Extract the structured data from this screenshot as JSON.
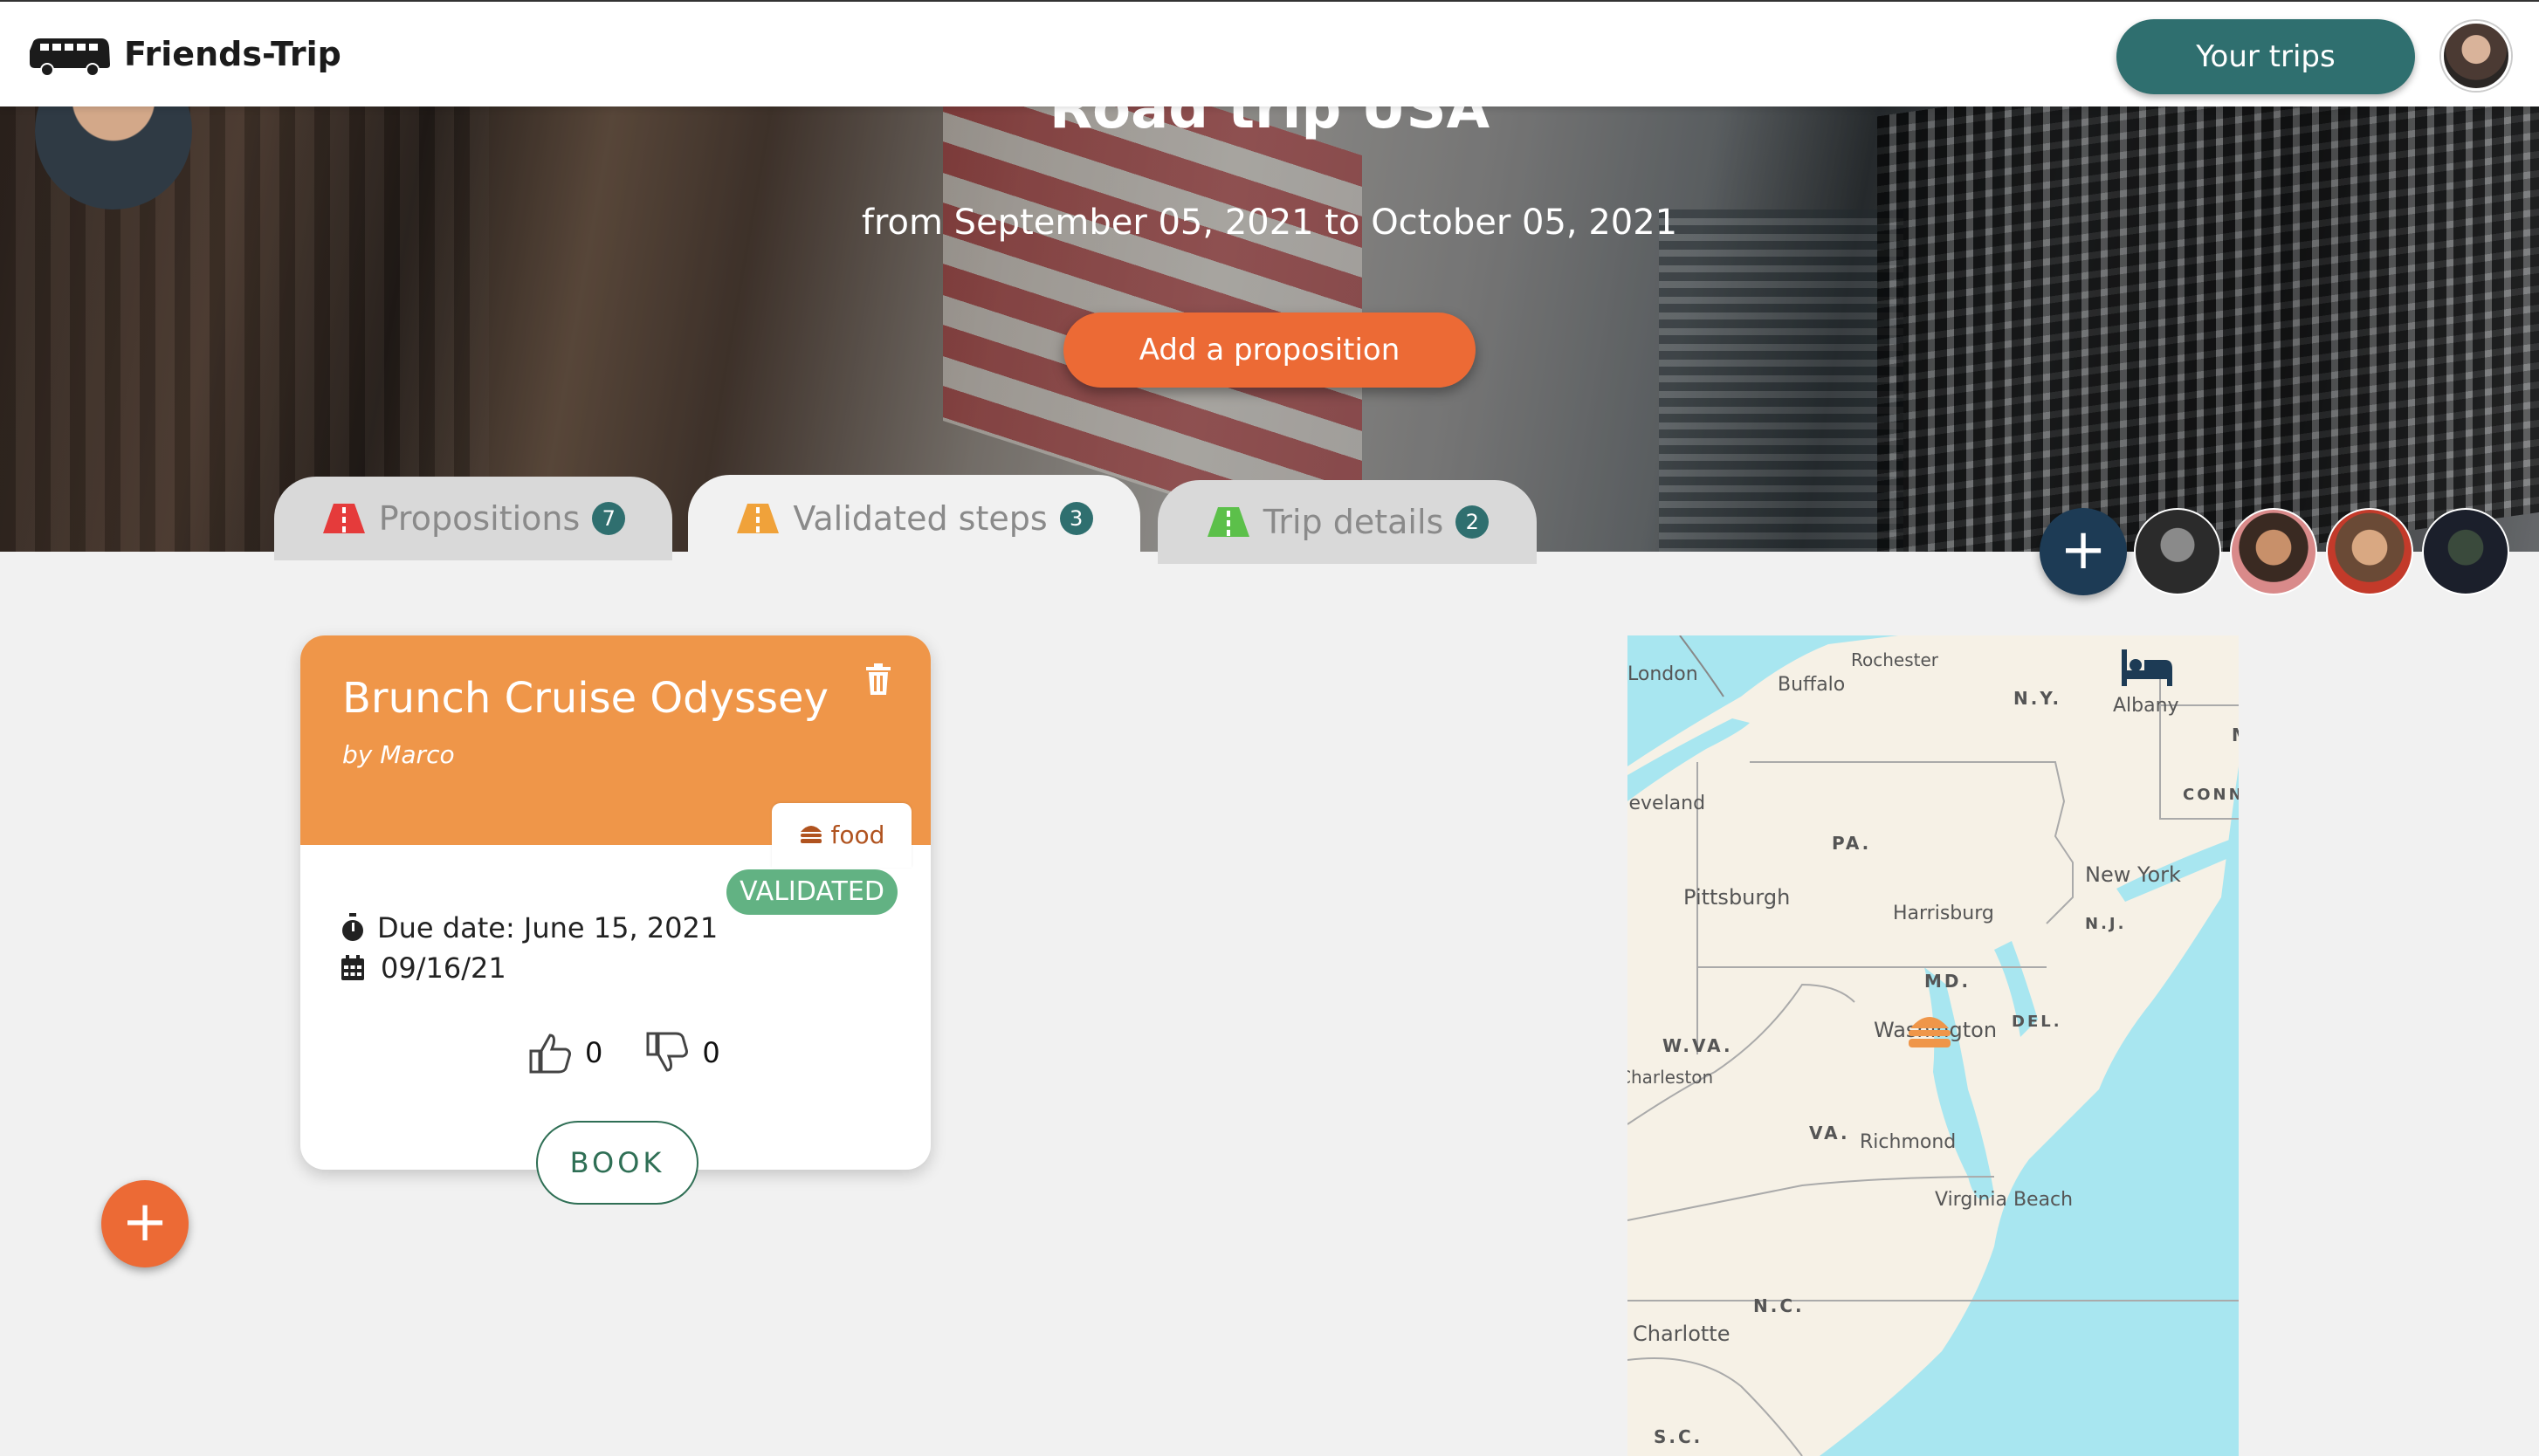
{
  "header": {
    "brand": "Friends-Trip",
    "your_trips_label": "Your trips"
  },
  "hero": {
    "title": "Road trip USA",
    "dates": "from September 05, 2021 to October 05, 2021",
    "add_proposition_label": "Add a proposition"
  },
  "tabs": [
    {
      "label": "Propositions",
      "count": "7",
      "icon": "road-red-icon",
      "color": "#e53b3b"
    },
    {
      "label": "Validated steps",
      "count": "3",
      "icon": "road-orange-icon",
      "color": "#f0a23a"
    },
    {
      "label": "Trip details",
      "count": "2",
      "icon": "road-green-icon",
      "color": "#5cc04a"
    }
  ],
  "members": {
    "add_label": "+"
  },
  "card": {
    "title": "Brunch Cruise Odyssey",
    "author": "by Marco",
    "tag": "food",
    "status": "VALIDATED",
    "due_date": "Due date: June 15, 2021",
    "date": "09/16/21",
    "likes": "0",
    "dislikes": "0",
    "book_label": "BOOK"
  },
  "fab_label": "+",
  "map": {
    "labels": {
      "london": "London",
      "buffalo": "Buffalo",
      "rochester": "Rochester",
      "albany": "Albany",
      "cleveland": "Cleveland",
      "pittsburgh": "Pittsburgh",
      "harrisburg": "Harrisburg",
      "new_york": "New York",
      "washington": "Washington",
      "charleston": "Charleston",
      "richmond": "Richmond",
      "virginia_beach": "Virginia Beach",
      "charlotte": "Charlotte"
    },
    "states": {
      "ny": "N.Y.",
      "m": "M",
      "conn": "CONN",
      "pa": "PA.",
      "nj": "N.J.",
      "md": "MD.",
      "del": "DEL.",
      "wva": "W.VA.",
      "va": "VA.",
      "nc": "N.C.",
      "sc": "S.C."
    }
  },
  "colors": {
    "accent_orange": "#ec6a35",
    "card_orange": "#ef9649",
    "teal": "#2f6f6f",
    "validated_green": "#62b283",
    "water": "#a8e6f0"
  }
}
